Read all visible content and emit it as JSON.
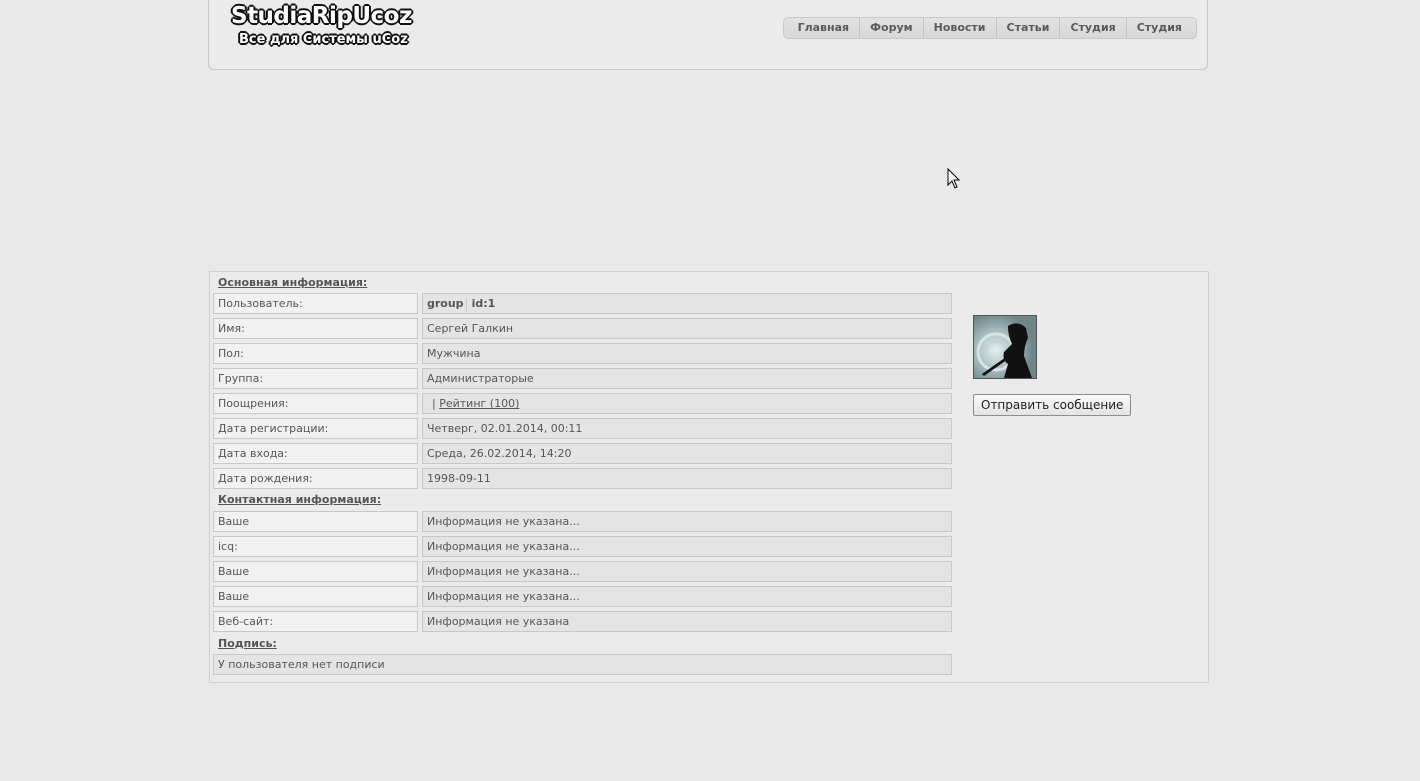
{
  "header": {
    "logo_line1": "StudiaRipUcoz",
    "logo_line2": "Все для Системы uCoz",
    "nav": [
      "Главная",
      "Форум",
      "Новости",
      "Статьи",
      "Студия",
      "Студия"
    ]
  },
  "profile": {
    "main_title": "Основная информация:",
    "main_rows": [
      {
        "label": "Пользователь:",
        "value_bold1": "group",
        "value_bold2": "id:1"
      },
      {
        "label": "Имя:",
        "value": "Сергей Галкин"
      },
      {
        "label": "Пол:",
        "value": "Мужчина"
      },
      {
        "label": "Группа:",
        "value": "Администраторые"
      },
      {
        "label": "Поощрения:",
        "value_prefix": "|",
        "value_link": "Рейтинг (100)"
      },
      {
        "label": "Дата регистрации:",
        "value": "Четверг, 02.01.2014, 00:11"
      },
      {
        "label": "Дата входа:",
        "value": "Среда, 26.02.2014, 14:20"
      },
      {
        "label": "Дата рождения:",
        "value": "1998-09-11"
      }
    ],
    "contact_title": "Контактная информация:",
    "contact_rows": [
      {
        "label": "Ваше",
        "value": "Информация не указана..."
      },
      {
        "label": "icq:",
        "value": "Информация не указана..."
      },
      {
        "label": "Ваше",
        "value": "Информация не указана..."
      },
      {
        "label": "Ваше",
        "value": "Информация не указана..."
      },
      {
        "label": "Веб-сайт:",
        "value": "Информация не указана"
      }
    ],
    "signature_title": "Подпись:",
    "signature_value": "У пользователя нет подписи",
    "send_button": "Отправить сообщение"
  }
}
